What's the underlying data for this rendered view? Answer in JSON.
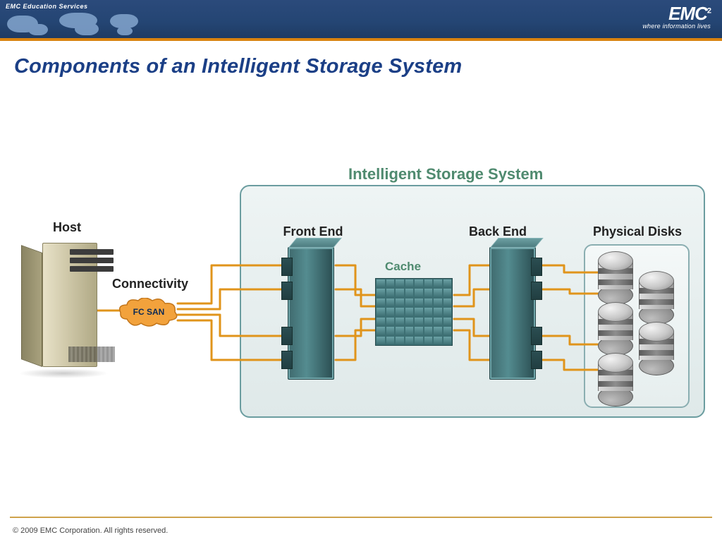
{
  "banner": {
    "brand_left": "EMC Education Services",
    "brand_right": "EMC",
    "brand_exponent": "2",
    "tagline": "where information lives"
  },
  "slide": {
    "title": "Components of an Intelligent Storage System"
  },
  "diagram": {
    "system_title": "Intelligent Storage System",
    "host_label": "Host",
    "connectivity_label": "Connectivity",
    "san_cloud_label": "FC SAN",
    "front_end_label": "Front End",
    "back_end_label": "Back End",
    "cache_label": "Cache",
    "disks_label": "Physical Disks"
  },
  "footer": {
    "copyright": "© 2009 EMC Corporation. All rights reserved."
  },
  "palette": {
    "brand_blue": "#1e3b63",
    "accent_orange": "#e0941b",
    "diagram_green": "#4f8a6f",
    "title_blue": "#1b3f86"
  }
}
